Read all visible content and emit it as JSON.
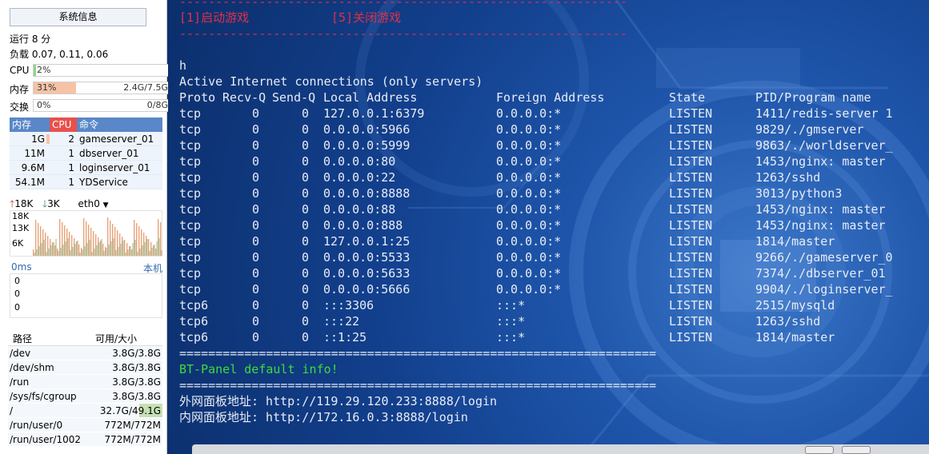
{
  "sidebar": {
    "sysinfo_button": "系统信息",
    "uptime": "运行 8 分",
    "load": "负载 0.07, 0.11, 0.06",
    "cpu": {
      "label": "CPU",
      "percent": "2%",
      "fraction": 0.02
    },
    "mem": {
      "label": "内存",
      "percent": "31%",
      "value": "2.4G/7.5G",
      "fraction": 0.31
    },
    "swap": {
      "label": "交换",
      "percent": "0%",
      "value": "0/8G",
      "fraction": 0
    },
    "process_table": {
      "headers": [
        "内存",
        "CPU",
        "命令"
      ],
      "rows": [
        {
          "mem": "1G",
          "cpu": "2",
          "cmd": "gameserver_01"
        },
        {
          "mem": "11M",
          "cpu": "1",
          "cmd": "dbserver_01"
        },
        {
          "mem": "9.6M",
          "cpu": "1",
          "cmd": "loginserver_01"
        },
        {
          "mem": "54.1M",
          "cpu": "1",
          "cmd": "YDService"
        }
      ]
    },
    "network": {
      "up": "18K",
      "down": "3K",
      "iface": "eth0",
      "y_labels": [
        "18K",
        "13K",
        "6K"
      ]
    },
    "ping": {
      "latency": "0ms",
      "host": "本机",
      "values": [
        "0",
        "0",
        "0"
      ]
    },
    "disk_table": {
      "headers": [
        "路径",
        "可用/大小"
      ],
      "rows": [
        {
          "path": "/dev",
          "size": "3.8G/3.8G",
          "used": 0.0
        },
        {
          "path": "/dev/shm",
          "size": "3.8G/3.8G",
          "used": 0.0
        },
        {
          "path": "/run",
          "size": "3.8G/3.8G",
          "used": 0.0
        },
        {
          "path": "/sys/fs/cgroup",
          "size": "3.8G/3.8G",
          "used": 0.0
        },
        {
          "path": "/",
          "size": "32.7G/49.1G",
          "used": 0.33
        },
        {
          "path": "/run/user/0",
          "size": "772M/772M",
          "used": 0.0
        },
        {
          "path": "/run/user/1002",
          "size": "772M/772M",
          "used": 0.0
        }
      ]
    }
  },
  "terminal": {
    "dash_line": "--------------------------------------------------------------",
    "menu_start": "[1]启动游戏",
    "menu_stop": "[5]关闭游戏",
    "prompt_char": "h",
    "netstat_title": "Active Internet connections (only servers)",
    "netstat_headers": [
      "Proto",
      "Recv-Q",
      "Send-Q",
      "Local Address",
      "Foreign Address",
      "State",
      "PID/Program name"
    ],
    "netstat_rows": [
      [
        "tcp",
        "0",
        "0",
        "127.0.0.1:6379",
        "0.0.0.0:*",
        "LISTEN",
        "1411/redis-server 1"
      ],
      [
        "tcp",
        "0",
        "0",
        "0.0.0.0:5966",
        "0.0.0.0:*",
        "LISTEN",
        "9829/./gmserver"
      ],
      [
        "tcp",
        "0",
        "0",
        "0.0.0.0:5999",
        "0.0.0.0:*",
        "LISTEN",
        "9863/./worldserver_"
      ],
      [
        "tcp",
        "0",
        "0",
        "0.0.0.0:80",
        "0.0.0.0:*",
        "LISTEN",
        "1453/nginx: master"
      ],
      [
        "tcp",
        "0",
        "0",
        "0.0.0.0:22",
        "0.0.0.0:*",
        "LISTEN",
        "1263/sshd"
      ],
      [
        "tcp",
        "0",
        "0",
        "0.0.0.0:8888",
        "0.0.0.0:*",
        "LISTEN",
        "3013/python3"
      ],
      [
        "tcp",
        "0",
        "0",
        "0.0.0.0:88",
        "0.0.0.0:*",
        "LISTEN",
        "1453/nginx: master"
      ],
      [
        "tcp",
        "0",
        "0",
        "0.0.0.0:888",
        "0.0.0.0:*",
        "LISTEN",
        "1453/nginx: master"
      ],
      [
        "tcp",
        "0",
        "0",
        "127.0.0.1:25",
        "0.0.0.0:*",
        "LISTEN",
        "1814/master"
      ],
      [
        "tcp",
        "0",
        "0",
        "0.0.0.0:5533",
        "0.0.0.0:*",
        "LISTEN",
        "9266/./gameserver_0"
      ],
      [
        "tcp",
        "0",
        "0",
        "0.0.0.0:5633",
        "0.0.0.0:*",
        "LISTEN",
        "7374/./dbserver_01"
      ],
      [
        "tcp",
        "0",
        "0",
        "0.0.0.0:5666",
        "0.0.0.0:*",
        "LISTEN",
        "9904/./loginserver_"
      ],
      [
        "tcp6",
        "0",
        "0",
        ":::3306",
        ":::*",
        "LISTEN",
        "2515/mysqld"
      ],
      [
        "tcp6",
        "0",
        "0",
        ":::22",
        ":::*",
        "LISTEN",
        "1263/sshd"
      ],
      [
        "tcp6",
        "0",
        "0",
        "::1:25",
        ":::*",
        "LISTEN",
        "1814/master"
      ]
    ],
    "eq_line": "==================================================================",
    "bt_title": "BT-Panel default info!",
    "outer_url_line": "外网面板地址: http://119.29.120.233:8888/login",
    "inner_url_line": "内网面板地址: http://172.16.0.3:8888/login"
  },
  "colors": {
    "terminal_bg": "#123f8c",
    "menu_red": "#e0304a",
    "bt_green": "#3cdc3c",
    "header_blue": "#5a87c8",
    "header_red": "#e8504d"
  }
}
